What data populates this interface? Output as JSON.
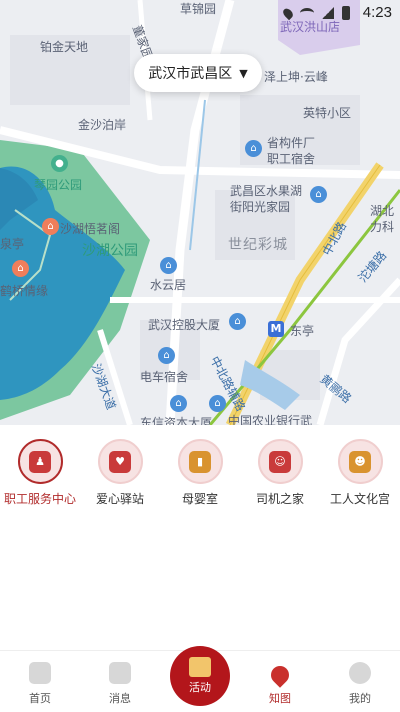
{
  "status_bar": {
    "time": "4:23"
  },
  "map": {
    "district_selector": "武汉市武昌区",
    "labels": {
      "jinjin": "铂金天地",
      "dongjiayuan": "董家园",
      "jinsha": "金沙泊岸",
      "yingte": "英特小区",
      "zeshang": "泽上坤·云峰",
      "shenggoujian": "省构件厂",
      "zhigong": "职工宿舍",
      "qinyuan": "琴园公园",
      "shahu_tea": "沙湖悟茗阁",
      "shahu_park": "沙湖公园",
      "quanting": "泉亭",
      "hequeqing": "鹤桥情缘",
      "wuchang_water": "武昌区水果湖",
      "jieyang": "街阳光家园",
      "shiji": "世纪彩城",
      "shuiyun": "水云居",
      "wuhan_kong": "武汉控股大厦",
      "dongting": "东亭",
      "diancheng": "电车宿舍",
      "zhongbei_road": "中北路辅路",
      "zhongbei": "中北路",
      "shahu_avenue": "沙湖大道",
      "huanghe": "黄鹂路",
      "yanxi": "沱塘路",
      "nongye": "中国农业银行武",
      "dongxin": "东信资本大厦",
      "hubei": "湖北",
      "hubei2": "力科",
      "hongshan": "武汉洪山店",
      "caoqiao": "草锦园"
    }
  },
  "services": [
    {
      "label": "职工服务中心",
      "icon": "worker-service-icon",
      "active": true
    },
    {
      "label": "爱心驿站",
      "icon": "heart-station-icon",
      "active": false
    },
    {
      "label": "母婴室",
      "icon": "baby-bottle-icon",
      "active": false
    },
    {
      "label": "司机之家",
      "icon": "driver-icon",
      "active": false
    },
    {
      "label": "工人文化宫",
      "icon": "culture-palace-icon",
      "active": false
    }
  ],
  "bottom_nav": {
    "home": "首页",
    "messages": "消息",
    "activity": "活动",
    "map": "知图",
    "mine": "我的"
  },
  "colors": {
    "accent": "#b3161b",
    "map_bg": "#eceef2",
    "water": "#2e8fb8",
    "park": "#4fb58a"
  }
}
